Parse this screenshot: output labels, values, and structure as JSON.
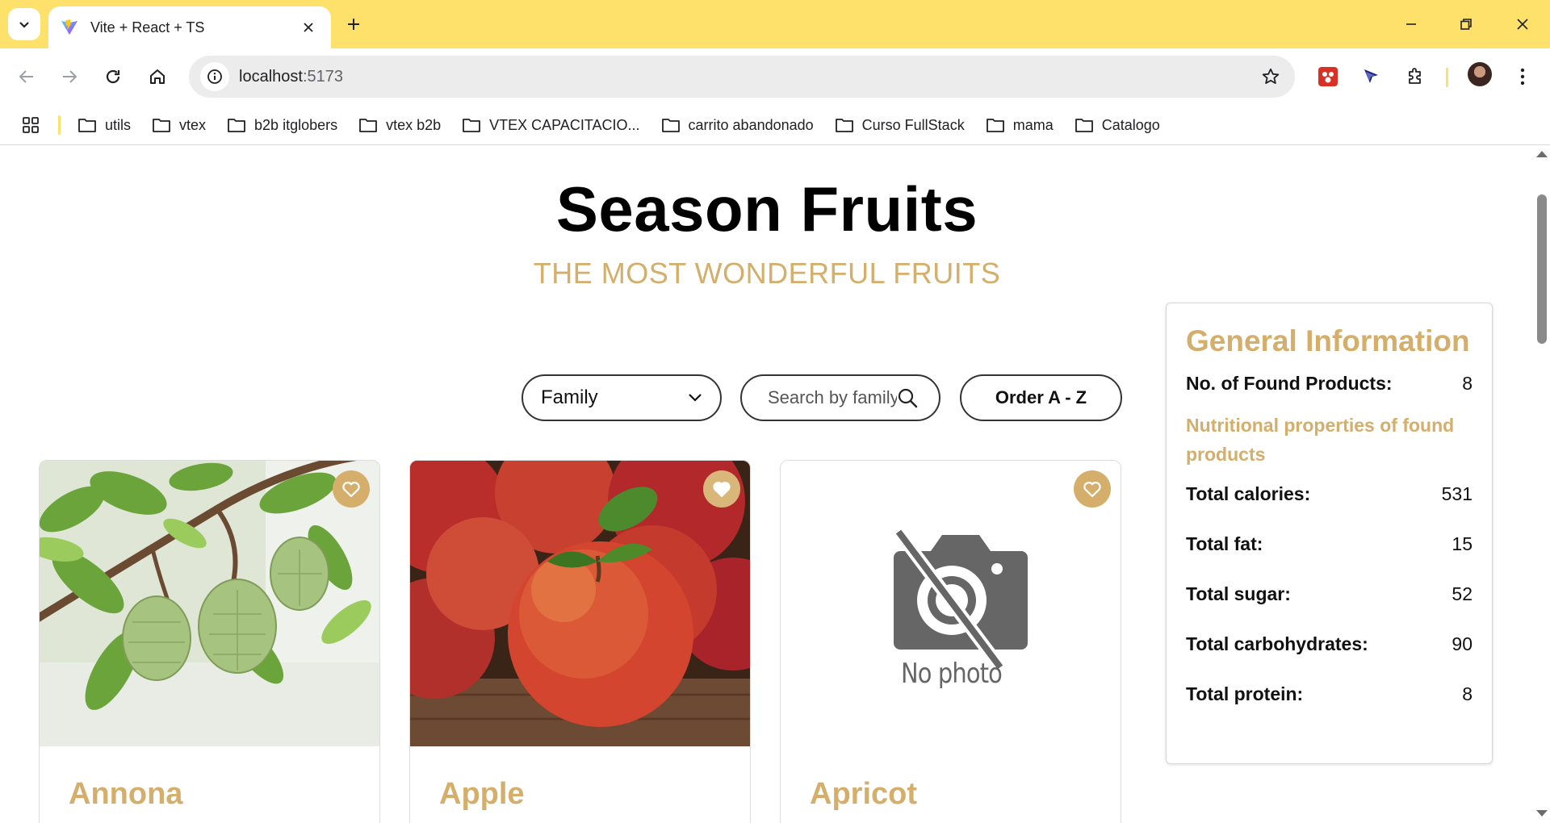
{
  "browser": {
    "tab_title": "Vite + React + TS",
    "url_host": "localhost",
    "url_port": ":5173",
    "bookmarks": [
      "utils",
      "vtex",
      "b2b itglobers",
      "vtex b2b",
      "VTEX CAPACITACIO...",
      "carrito abandonado",
      "Curso FullStack",
      "mama",
      "Catalogo"
    ],
    "accent_color": "#fde16a"
  },
  "page": {
    "title": "Season Fruits",
    "subtitle": "THE MOST WONDERFUL FRUITS",
    "accent_color": "#d4ae6a"
  },
  "filters": {
    "family_select": "Family",
    "search_placeholder": "Search by family",
    "order_label": "Order A - Z"
  },
  "products": [
    {
      "name": "Annona",
      "image": "annona-photo"
    },
    {
      "name": "Apple",
      "image": "apple-photo"
    },
    {
      "name": "Apricot",
      "image": "no-photo",
      "no_photo_text": "No photo"
    }
  ],
  "info": {
    "title": "General Information",
    "found_label": "No. of Found Products:",
    "found_value": "8",
    "nutrition_heading": "Nutritional properties of found products",
    "rows": [
      {
        "label": "Total calories:",
        "value": "531"
      },
      {
        "label": "Total fat:",
        "value": "15"
      },
      {
        "label": "Total sugar:",
        "value": "52"
      },
      {
        "label": "Total carbohydrates:",
        "value": "90"
      },
      {
        "label": "Total protein:",
        "value": "8"
      }
    ]
  }
}
